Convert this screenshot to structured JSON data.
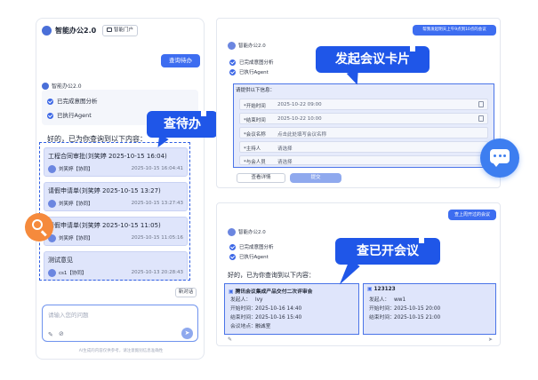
{
  "app": {
    "name": "智能办公2.0",
    "portal_label": "智能门户"
  },
  "left_chat": {
    "user_query": "查询待办",
    "bot_name": "智能办公2.0",
    "status_items": [
      "已完成意图分析",
      "已执行Agent"
    ],
    "intro": "好的，已为你查询到以下内容：",
    "todos": [
      {
        "title": "工程合同审批(刘笑婷 2025-10-15 16:04)",
        "person": "刘笑婷【协同】",
        "date": "2025-10-15 16:04:41"
      },
      {
        "title": "请假申请单(刘笑婷 2025-10-15 13:27)",
        "person": "刘笑婷【协同】",
        "date": "2025-10-15 13:27:43"
      },
      {
        "title": "请假申请单(刘笑婷 2025-10-15 11:05)",
        "person": "刘笑婷【协同】",
        "date": "2025-10-15 11:05:16"
      },
      {
        "title": "测试意见",
        "person": "cs1【协同】",
        "date": "2025-10-13 20:28:43"
      }
    ],
    "new_chat_label": "新对话",
    "input_placeholder": "请输入您的问题",
    "footer": "AI生成的内容仅供参考，请注意甄别信息准确性"
  },
  "callouts": {
    "todo": "查待办",
    "meeting_card": "发起会议卡片",
    "attended": "查已开会议"
  },
  "top_right": {
    "user_query": "帮我发起明天上午9点到10点的会议",
    "bot_name": "智能办公2.0",
    "status_items": [
      "已完成意图分析",
      "已执行Agent"
    ],
    "form_title": "请提供以下信息：",
    "form_fields": [
      {
        "label": "*开始时间",
        "value": "2025-10-22 09:00",
        "icon": "calendar-icon"
      },
      {
        "label": "*结束时间",
        "value": "2025-10-22 10:00",
        "icon": "calendar-icon"
      },
      {
        "label": "*会议名称",
        "value": "点击此处填写会议名称",
        "icon": ""
      },
      {
        "label": "*主持人",
        "value": "请选择",
        "icon": ""
      },
      {
        "label": "*与会人员",
        "value": "请选择",
        "icon": ""
      }
    ],
    "btn_detail": "查看详情",
    "btn_submit": "提交"
  },
  "bottom_right": {
    "user_query": "查上周开过的会议",
    "bot_name": "智能办公2.0",
    "status_items": [
      "已完成意图分析",
      "已执行Agent"
    ],
    "intro": "好的，已为你查询到以下内容：",
    "meetings": [
      {
        "title": "腾讯会议集成产品交付二次评审会",
        "rows": [
          [
            "发起人：",
            "lvy"
          ],
          [
            "开始时间：",
            "2025-10-16 14:40"
          ],
          [
            "结束时间：",
            "2025-10-16 15:40"
          ],
          [
            "会议地点：",
            "融诚室"
          ]
        ]
      },
      {
        "title": "123123",
        "rows": [
          [
            "发起人：",
            "ww1"
          ],
          [
            "开始时间：",
            "2025-10-15 20:00"
          ],
          [
            "结束时间：",
            "2025-10-15 21:00"
          ]
        ]
      }
    ]
  },
  "colors": {
    "accent": "#1f56e8",
    "card_bg": "#dfe5fb",
    "search_badge": "#f58a3c",
    "chat_fab": "#3d7ef0"
  }
}
